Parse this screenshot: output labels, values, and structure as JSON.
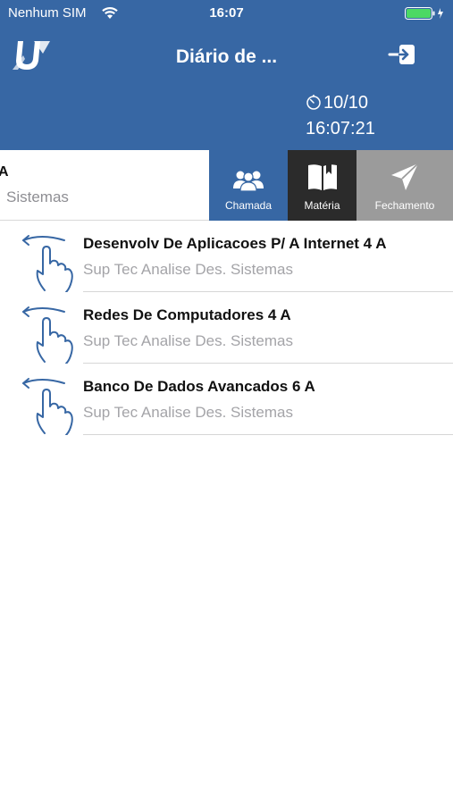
{
  "status_bar": {
    "carrier": "Nenhum SIM",
    "time": "16:07"
  },
  "nav": {
    "title": "Diário de ...",
    "logo_icon": "app-logo-u",
    "logout_icon": "logout-icon"
  },
  "clock": {
    "date": "10/10",
    "time": "16:07:21"
  },
  "subheader": {
    "title": "A",
    "course": "Sistemas"
  },
  "tabs": [
    {
      "label": "Chamada",
      "icon": "people-icon"
    },
    {
      "label": "Matéria",
      "icon": "book-icon"
    },
    {
      "label": "Fechamento",
      "icon": "send-icon"
    }
  ],
  "subjects": [
    {
      "title": "Desenvolv De Aplicacoes P/ A Internet 4 A",
      "course": "Sup Tec Analise Des. Sistemas"
    },
    {
      "title": "Redes De Computadores 4 A",
      "course": "Sup Tec Analise Des. Sistemas"
    },
    {
      "title": "Banco De Dados Avancados 6 A",
      "course": "Sup Tec Analise Des. Sistemas"
    }
  ],
  "colors": {
    "header_blue": "#3767a4",
    "tab_active_dark": "#2b2b2b",
    "tab_disabled_gray": "#9b9b9b",
    "battery_green": "#4cd964"
  }
}
